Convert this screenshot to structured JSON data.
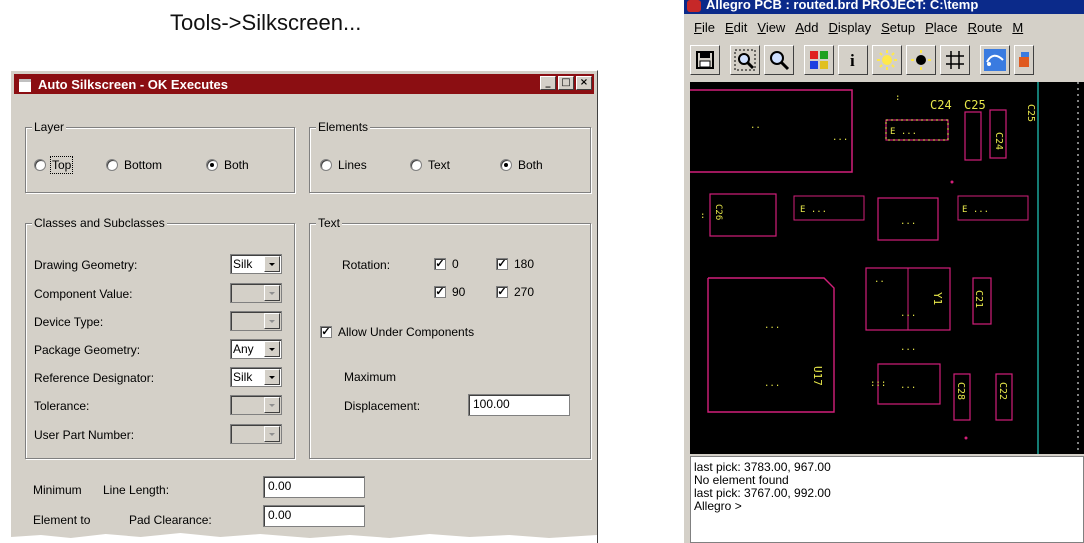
{
  "heading": "Tools->Silkscreen...",
  "dialog": {
    "title": "Auto Silkscreen - OK Executes",
    "layer": {
      "legend": "Layer",
      "options": [
        "Top",
        "Bottom",
        "Both"
      ],
      "selected": "Both"
    },
    "elements": {
      "legend": "Elements",
      "options": [
        "Lines",
        "Text",
        "Both"
      ],
      "selected": "Both"
    },
    "classes": {
      "legend": "Classes and Subclasses",
      "rows": [
        {
          "label": "Drawing Geometry:",
          "value": "Silk",
          "enabled": true
        },
        {
          "label": "Component Value:",
          "value": "",
          "enabled": false
        },
        {
          "label": "Device Type:",
          "value": "",
          "enabled": false
        },
        {
          "label": "Package Geometry:",
          "value": "Any",
          "enabled": true
        },
        {
          "label": "Reference Designator:",
          "value": "Silk",
          "enabled": true
        },
        {
          "label": "Tolerance:",
          "value": "",
          "enabled": false
        },
        {
          "label": "User Part Number:",
          "value": "",
          "enabled": false
        }
      ]
    },
    "text": {
      "legend": "Text",
      "rotation_label": "Rotation:",
      "rotations": [
        {
          "label": "0",
          "checked": true
        },
        {
          "label": "180",
          "checked": true
        },
        {
          "label": "90",
          "checked": true
        },
        {
          "label": "270",
          "checked": true
        }
      ],
      "allow_under_components": "Allow Under Components",
      "allow_under_checked": true,
      "maximum_label": "Maximum",
      "displacement_label": "Displacement:",
      "displacement_value": "100.00"
    },
    "bottom": {
      "minimum_label": "Minimum",
      "line_length_label": "Line Length:",
      "line_length_value": "0.00",
      "element_to_label": "Element to",
      "pad_clearance_label": "Pad Clearance:",
      "pad_clearance_value": "0.00"
    }
  },
  "allegro": {
    "title": "Allegro PCB : routed.brd  PROJECT: C:\\temp",
    "menu": [
      "File",
      "Edit",
      "View",
      "Add",
      "Display",
      "Setup",
      "Place",
      "Route",
      "M"
    ],
    "toolbar_icons": [
      "save-icon",
      "zoom-window-icon",
      "zoom-icon",
      "color-icon",
      "info-icon",
      "shadow-icon",
      "highlight-icon",
      "grid-icon",
      "rats-icon",
      "route-icon"
    ],
    "refdes": [
      "C24",
      "C25",
      "C24",
      "C25",
      "C26",
      "C21",
      "Y1",
      "U17",
      "C28",
      "C22"
    ],
    "console": [
      "last pick:  3783.00, 967.00",
      "No element found",
      "last pick:  3767.00, 992.00",
      "Allegro >"
    ],
    "colors": {
      "canvas": "#000000",
      "silk": "#d21f7a",
      "pads": "#e8e84a",
      "board_outline": "#1aa59a",
      "title_bar": "#0b2a8a"
    }
  }
}
